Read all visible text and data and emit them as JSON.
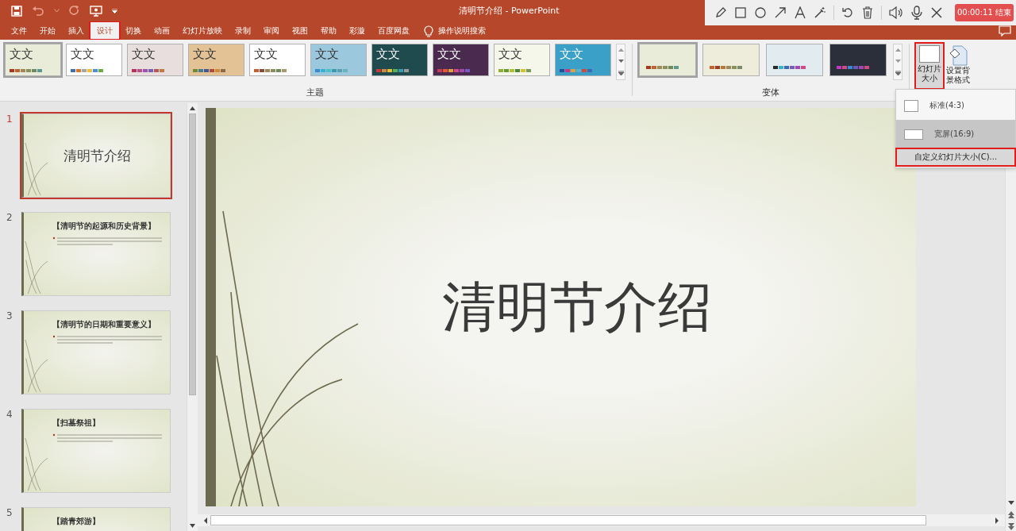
{
  "app_title": "清明节介绍 - PowerPoint",
  "recorder": {
    "timer": "00:00:11",
    "end": "结束"
  },
  "tabs": [
    {
      "label": "文件",
      "selected": false,
      "highlighted": false
    },
    {
      "label": "开始",
      "selected": false,
      "highlighted": false
    },
    {
      "label": "插入",
      "selected": false,
      "highlighted": false
    },
    {
      "label": "设计",
      "selected": true,
      "highlighted": true
    },
    {
      "label": "切换",
      "selected": false,
      "highlighted": false
    },
    {
      "label": "动画",
      "selected": false,
      "highlighted": false
    },
    {
      "label": "幻灯片放映",
      "selected": false,
      "highlighted": false
    },
    {
      "label": "录制",
      "selected": false,
      "highlighted": false
    },
    {
      "label": "审阅",
      "selected": false,
      "highlighted": false
    },
    {
      "label": "视图",
      "selected": false,
      "highlighted": false
    },
    {
      "label": "帮助",
      "selected": false,
      "highlighted": false
    },
    {
      "label": "彩漩",
      "selected": false,
      "highlighted": false
    },
    {
      "label": "百度网盘",
      "selected": false,
      "highlighted": false
    }
  ],
  "tell_me": "操作说明搜索",
  "themes": {
    "label": "主题",
    "items": [
      {
        "text": "文文",
        "color": "#e9ecd9",
        "dark": false,
        "selected": true,
        "swatches": [
          {
            "color": "#a33a20"
          },
          {
            "color": "#c0612f"
          },
          {
            "color": "#9b8a5b"
          },
          {
            "color": "#8b8f5b"
          },
          {
            "color": "#6f8a5e"
          },
          {
            "color": "#5d9a8e"
          }
        ]
      },
      {
        "text": "文文",
        "color": "#ffffff",
        "dark": false,
        "selected": false,
        "swatches": [
          {
            "color": "#3d6fb5"
          },
          {
            "color": "#d9762b"
          },
          {
            "color": "#a5a5a5"
          },
          {
            "color": "#f2be3a"
          },
          {
            "color": "#4a8fd1"
          },
          {
            "color": "#6aac4a"
          }
        ]
      },
      {
        "text": "文文",
        "color": "#e8dede",
        "dark": false,
        "selected": false,
        "swatches": [
          {
            "color": "#b0345c"
          },
          {
            "color": "#c04a8a"
          },
          {
            "color": "#9a55b0"
          },
          {
            "color": "#7b5fb5"
          },
          {
            "color": "#b05a5a"
          },
          {
            "color": "#c07a40"
          }
        ]
      },
      {
        "text": "文文",
        "color": "#e3c396",
        "dark": false,
        "selected": false,
        "swatches": [
          {
            "color": "#6b8a3a"
          },
          {
            "color": "#4a7a8a"
          },
          {
            "color": "#3a5a9a"
          },
          {
            "color": "#b04a3a"
          },
          {
            "color": "#d08a3a"
          },
          {
            "color": "#8a6a4a"
          }
        ]
      },
      {
        "text": "文文",
        "color": "#ffffff",
        "dark": false,
        "selected": false,
        "swatches": [
          {
            "color": "#c0612f"
          },
          {
            "color": "#8a4a3a"
          },
          {
            "color": "#9b8a5b"
          },
          {
            "color": "#8b8f5b"
          },
          {
            "color": "#6f8a5e"
          },
          {
            "color": "#a89a6a"
          }
        ]
      },
      {
        "text": "文文",
        "color": "#9cc8de",
        "dark": false,
        "selected": false,
        "swatches": [
          {
            "color": "#3a8ad0"
          },
          {
            "color": "#3ab0d0"
          },
          {
            "color": "#4ac0c0"
          },
          {
            "color": "#3a9ab0"
          },
          {
            "color": "#5aa0b0"
          },
          {
            "color": "#6ab0c0"
          }
        ]
      },
      {
        "text": "文文",
        "color": "#1f4b4f",
        "dark": true,
        "selected": false,
        "swatches": [
          {
            "color": "#c83a3a"
          },
          {
            "color": "#d08a3a"
          },
          {
            "color": "#e0c03a"
          },
          {
            "color": "#5ab05a"
          },
          {
            "color": "#3a9ab0"
          },
          {
            "color": "#9a9a9a"
          }
        ]
      },
      {
        "text": "文文",
        "color": "#4a2a4e",
        "dark": true,
        "selected": false,
        "swatches": [
          {
            "color": "#c83a5a"
          },
          {
            "color": "#e05a3a"
          },
          {
            "color": "#e0a03a"
          },
          {
            "color": "#d04a8a"
          },
          {
            "color": "#a04ab0"
          },
          {
            "color": "#7a5ac0"
          }
        ]
      },
      {
        "text": "文文",
        "color": "#f4f7ea",
        "dark": false,
        "selected": false,
        "swatches": [
          {
            "color": "#8ab03a"
          },
          {
            "color": "#6a9a2a"
          },
          {
            "color": "#b0c03a"
          },
          {
            "color": "#4a8a3a"
          },
          {
            "color": "#d0c03a"
          },
          {
            "color": "#7a9a5a"
          }
        ]
      },
      {
        "text": "文文",
        "color": "#3aa0c8",
        "dark": true,
        "selected": false,
        "swatches": [
          {
            "color": "#2a4a9a"
          },
          {
            "color": "#c03a8a"
          },
          {
            "color": "#e0a03a"
          },
          {
            "color": "#5ab0d0"
          },
          {
            "color": "#d04a3a"
          },
          {
            "color": "#3a6ab0"
          }
        ]
      }
    ]
  },
  "variants": {
    "label": "变体",
    "items": [
      {
        "color": "#e9ecd9",
        "selected": true,
        "swatches": [
          {
            "color": "#a33a20"
          },
          {
            "color": "#c0612f"
          },
          {
            "color": "#9b8a5b"
          },
          {
            "color": "#8b8f5b"
          },
          {
            "color": "#6f8a5e"
          },
          {
            "color": "#5d9a8e"
          }
        ]
      },
      {
        "color": "#eeeddb",
        "selected": false,
        "swatches": [
          {
            "color": "#c0612f"
          },
          {
            "color": "#a33a20"
          },
          {
            "color": "#b07a3a"
          },
          {
            "color": "#9b8a5b"
          },
          {
            "color": "#8b8f5b"
          },
          {
            "color": "#7a8a6a"
          }
        ]
      },
      {
        "color": "#e2ecf0",
        "selected": false,
        "swatches": [
          {
            "color": "#2a2a2a"
          },
          {
            "color": "#3ab0d0"
          },
          {
            "color": "#3a6ab0"
          },
          {
            "color": "#7a5ac0"
          },
          {
            "color": "#a04ab0"
          },
          {
            "color": "#d04a8a"
          }
        ]
      },
      {
        "color": "#2b2f3a",
        "selected": false,
        "swatches": [
          {
            "color": "#c03ac0"
          },
          {
            "color": "#d04a8a"
          },
          {
            "color": "#3a8ad0"
          },
          {
            "color": "#6a5ac0"
          },
          {
            "color": "#a04ab0"
          },
          {
            "color": "#d04a8a"
          }
        ]
      }
    ]
  },
  "slide_size": {
    "label": "幻灯片大小",
    "highlighted": true
  },
  "format_background": {
    "label": "设置背景格式"
  },
  "size_menu": [
    {
      "label": "标准(4:3)",
      "kind": "standard",
      "selected": false
    },
    {
      "label": "宽屏(16:9)",
      "kind": "wide",
      "selected": true
    },
    {
      "label": "自定义幻灯片大小(C)...",
      "kind": "custom",
      "highlighted": true
    }
  ],
  "slides": [
    {
      "number": "1",
      "kind": "title",
      "title": "清明节介绍",
      "selected": true
    },
    {
      "number": "2",
      "kind": "content",
      "title": "【清明节的起源和历史背景】",
      "selected": false
    },
    {
      "number": "3",
      "kind": "content",
      "title": "【清明节的日期和重要意义】",
      "selected": false
    },
    {
      "number": "4",
      "kind": "content",
      "title": "【扫墓祭祖】",
      "selected": false
    },
    {
      "number": "5",
      "kind": "content",
      "title": "【踏青郊游】",
      "selected": false
    }
  ],
  "editor": {
    "title": "清明节介绍"
  }
}
